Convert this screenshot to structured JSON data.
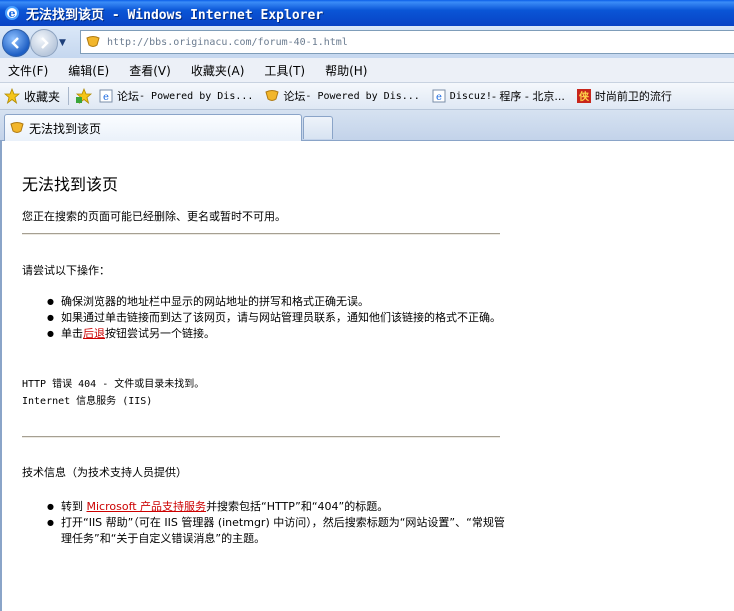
{
  "window": {
    "title": "无法找到该页 - Windows Internet Explorer"
  },
  "address": {
    "url": "http://bbs.originacu.com/forum-40-1.html"
  },
  "menu": [
    "文件(F)",
    "编辑(E)",
    "查看(V)",
    "收藏夹(A)",
    "工具(T)",
    "帮助(H)"
  ],
  "favorites": {
    "label": "收藏夹",
    "links": [
      {
        "t1": "论坛",
        "t2": " - Powered by Dis..."
      },
      {
        "t1": "论坛",
        "t2": " - Powered by Dis..."
      },
      {
        "t1": "Discuz!",
        "t2": " - 程序 - 北京..."
      },
      {
        "t1": "时尚前卫的流行",
        "t2": ""
      }
    ]
  },
  "tab": {
    "label": "无法找到该页"
  },
  "page": {
    "heading": "无法找到该页",
    "intro": "您正在搜索的页面可能已经删除、更名或暂时不可用。",
    "try_heading": "请尝试以下操作：",
    "try_items": {
      "item1": "确保浏览器的地址栏中显示的网站地址的拼写和格式正确无误。",
      "item2": "如果通过单击链接而到达了该网页，请与网站管理员联系，通知他们该链接的格式不正确。",
      "item3_pre": "单击",
      "item3_link": "后退",
      "item3_post": "按钮尝试另一个链接。"
    },
    "error_line1": "HTTP 错误 404 - 文件或目录未找到。",
    "error_line2": "Internet 信息服务 (IIS)",
    "tech_heading": "技术信息（为技术支持人员提供）",
    "tech_items": {
      "item1_pre": "转到 ",
      "item1_link": "Microsoft 产品支持服务",
      "item1_post": "并搜索包括“HTTP”和“404”的标题。",
      "item2": "打开“IIS 帮助”（可在 IIS 管理器 (inetmgr) 中访问），然后搜索标题为“网站设置”、“常规管理任务”和“关于自定义错误消息”的主题。"
    }
  }
}
